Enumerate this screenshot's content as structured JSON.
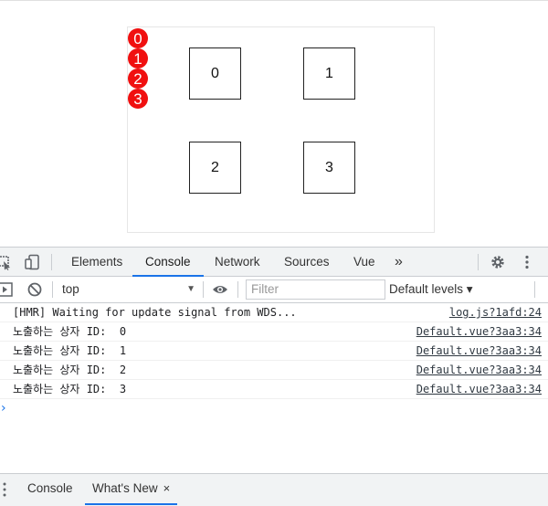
{
  "page": {
    "badges": [
      "0",
      "1",
      "2",
      "3"
    ],
    "boxes": [
      "0",
      "1",
      "2",
      "3"
    ]
  },
  "devtools": {
    "tabs": [
      "Elements",
      "Console",
      "Network",
      "Sources",
      "Vue"
    ],
    "active_tab": "Console",
    "more_tabs": "»",
    "context": "top",
    "filter_placeholder": "Filter",
    "log_levels": "Default levels ▾",
    "messages": [
      {
        "text": "[HMR] Waiting for update signal from WDS...",
        "source": "log.js?1afd:24"
      },
      {
        "text": "노출하는 상자 ID:  0",
        "source": "Default.vue?3aa3:34"
      },
      {
        "text": "노출하는 상자 ID:  1",
        "source": "Default.vue?3aa3:34"
      },
      {
        "text": "노출하는 상자 ID:  2",
        "source": "Default.vue?3aa3:34"
      },
      {
        "text": "노출하는 상자 ID:  3",
        "source": "Default.vue?3aa3:34"
      }
    ],
    "prompt": "›",
    "drawer_tabs": [
      "Console",
      "What's New"
    ],
    "drawer_close": "×"
  }
}
